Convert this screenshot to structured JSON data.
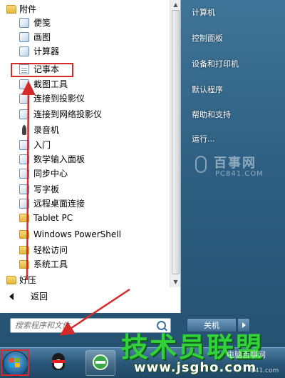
{
  "programs": {
    "items": [
      {
        "label": "附件",
        "icon": "folder-icon",
        "level": 0
      },
      {
        "label": "便笺",
        "icon": "sticky-notes-icon",
        "level": 1
      },
      {
        "label": "画图",
        "icon": "paint-icon",
        "level": 1
      },
      {
        "label": "计算器",
        "icon": "calculator-icon",
        "level": 1
      },
      {
        "label": "记事本",
        "icon": "notepad-icon",
        "level": 1
      },
      {
        "label": "截图工具",
        "icon": "snipping-tool-icon",
        "level": 1
      },
      {
        "label": "连接到投影仪",
        "icon": "projector-icon",
        "level": 1
      },
      {
        "label": "连接到网络投影仪",
        "icon": "network-projector-icon",
        "level": 1
      },
      {
        "label": "录音机",
        "icon": "microphone-icon",
        "level": 1
      },
      {
        "label": "入门",
        "icon": "getting-started-icon",
        "level": 1
      },
      {
        "label": "数学输入面板",
        "icon": "math-input-icon",
        "level": 1
      },
      {
        "label": "同步中心",
        "icon": "sync-center-icon",
        "level": 1
      },
      {
        "label": "写字板",
        "icon": "wordpad-icon",
        "level": 1
      },
      {
        "label": "远程桌面连接",
        "icon": "remote-desktop-icon",
        "level": 1
      },
      {
        "label": "Tablet PC",
        "icon": "folder-icon",
        "level": 1
      },
      {
        "label": "Windows PowerShell",
        "icon": "folder-icon",
        "level": 1
      },
      {
        "label": "轻松访问",
        "icon": "folder-icon",
        "level": 1
      },
      {
        "label": "系统工具",
        "icon": "folder-icon",
        "level": 1
      },
      {
        "label": "好压",
        "icon": "folder-icon",
        "level": 0
      }
    ],
    "highlighted": "记事本"
  },
  "back": {
    "label": "返回"
  },
  "search": {
    "placeholder": "搜索程序和文件"
  },
  "right_panel": {
    "items": [
      "计算机",
      "控制面板",
      "设备和打印机",
      "默认程序",
      "帮助和支持",
      "运行..."
    ],
    "shutdown_label": "关机"
  },
  "watermarks": {
    "baishi_title": "百事网",
    "baishi_url": "PC841.COM",
    "jsgho_title": "技术员联盟",
    "jsgho_url": "www.jsgho.com",
    "corner_text": "电脑百事网",
    "corner_url": "841.com"
  },
  "colors": {
    "highlight_red": "#d42a2a",
    "arrow_red": "#d42a2a",
    "watermark_green": "#33d13a"
  }
}
